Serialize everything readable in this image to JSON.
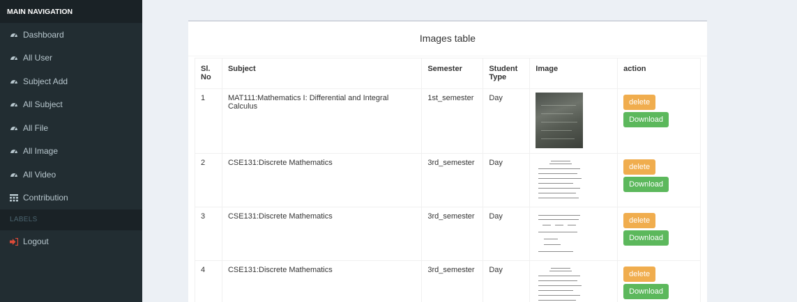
{
  "sidebar": {
    "header": "MAIN NAVIGATION",
    "items": [
      {
        "label": "Dashboard",
        "icon": "dashboard-icon"
      },
      {
        "label": "All User",
        "icon": "dashboard-icon"
      },
      {
        "label": "Subject Add",
        "icon": "dashboard-icon"
      },
      {
        "label": "All Subject",
        "icon": "dashboard-icon"
      },
      {
        "label": "All File",
        "icon": "dashboard-icon"
      },
      {
        "label": "All Image",
        "icon": "dashboard-icon"
      },
      {
        "label": "All Video",
        "icon": "dashboard-icon"
      },
      {
        "label": "Contribution",
        "icon": "table-icon"
      }
    ],
    "labels_header": "LABELS",
    "logout": {
      "label": "Logout",
      "icon": "sign-in-icon",
      "color": "#dd4b39"
    }
  },
  "panel": {
    "title": "Images table"
  },
  "table": {
    "headers": [
      "Sl. No",
      "Subject",
      "Semester",
      "Student Type",
      "Image",
      "action"
    ],
    "rows": [
      {
        "no": "1",
        "subject": "MAT111:Mathematics I: Differential and Integral Calculus",
        "semester": "1st_semester",
        "type": "Day",
        "image": "photo-thumbnail"
      },
      {
        "no": "2",
        "subject": "CSE131:Discrete Mathematics",
        "semester": "3rd_semester",
        "type": "Day",
        "image": "document-thumbnail"
      },
      {
        "no": "3",
        "subject": "CSE131:Discrete Mathematics",
        "semester": "3rd_semester",
        "type": "Day",
        "image": "document-thumbnail"
      },
      {
        "no": "4",
        "subject": "CSE131:Discrete Mathematics",
        "semester": "3rd_semester",
        "type": "Day",
        "image": "document-thumbnail"
      }
    ],
    "delete_label": "delete",
    "download_label": "Download"
  },
  "colors": {
    "sidebar_bg": "#222d32",
    "delete": "#f0ad4e",
    "download": "#5cb85c",
    "page_bg": "#ecf0f5"
  }
}
